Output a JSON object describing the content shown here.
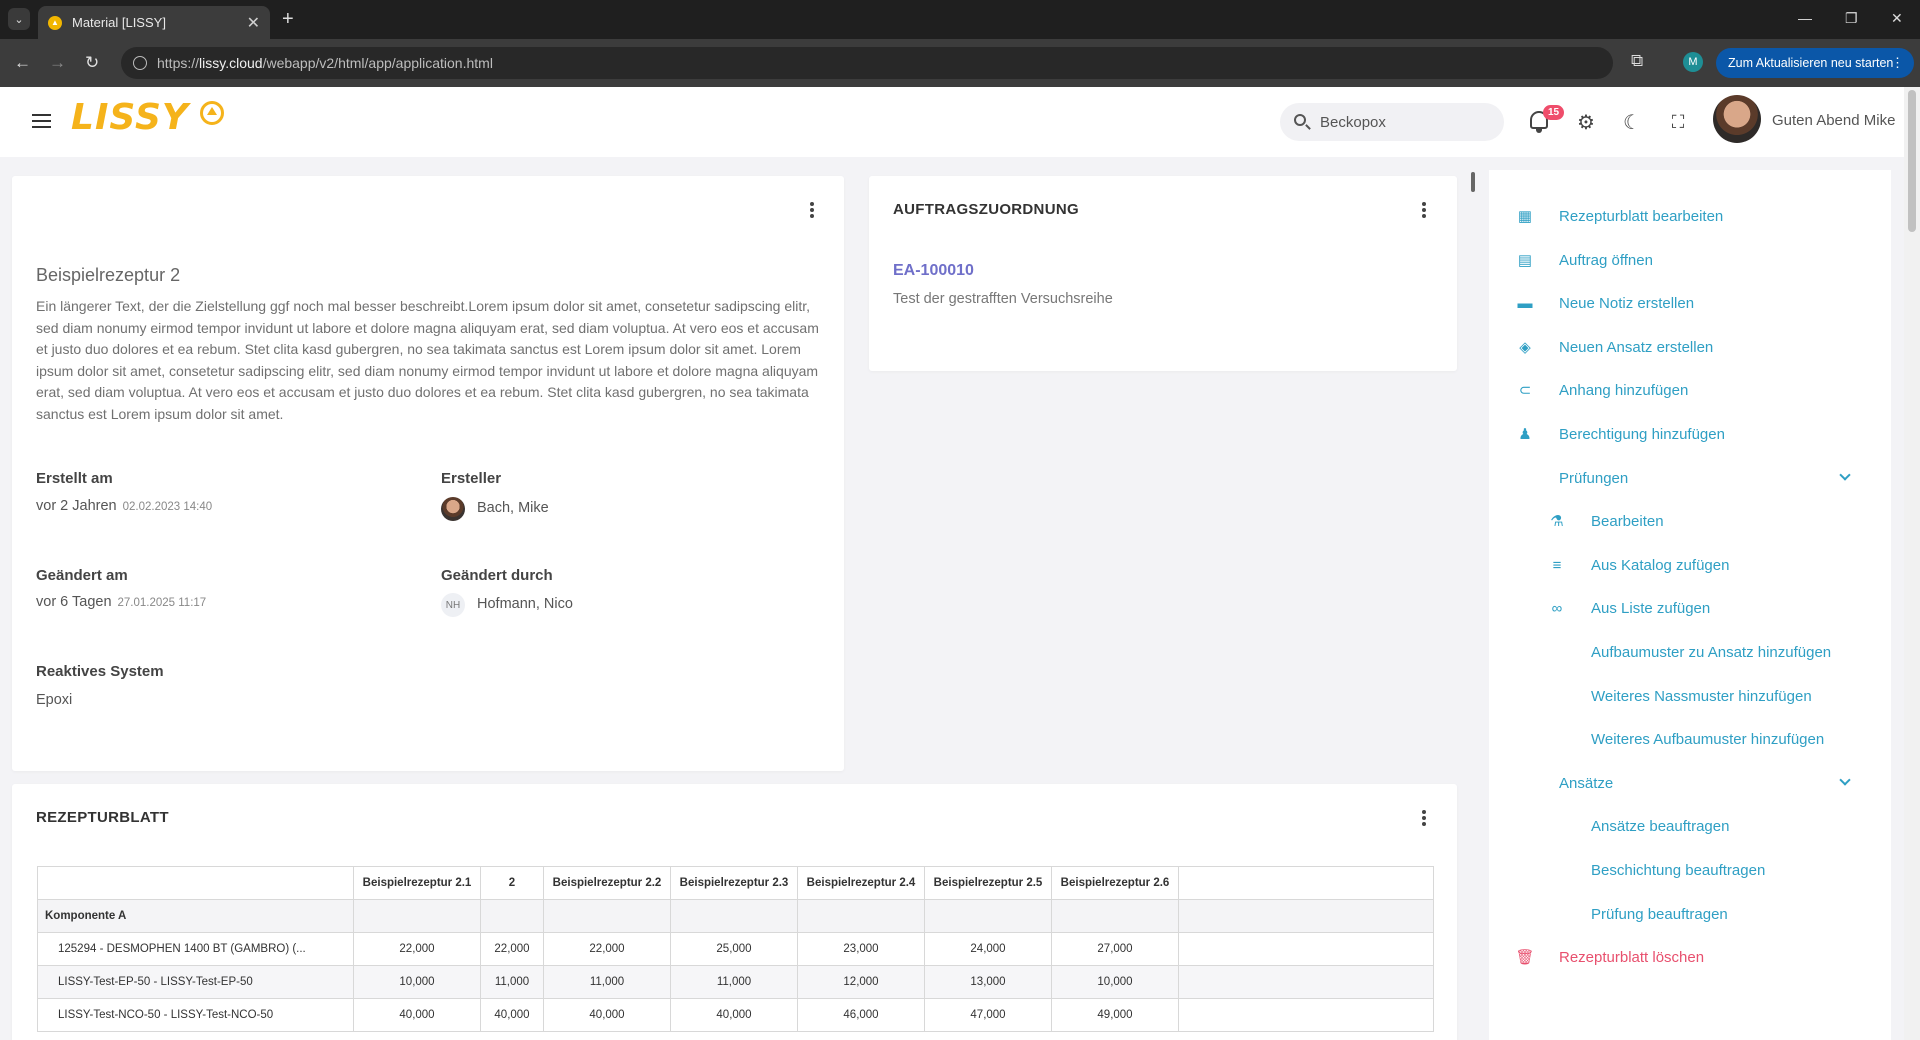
{
  "browser": {
    "tab_title": "Material [LISSY]",
    "url_scheme": "https://",
    "url_host": "lissy.cloud",
    "url_path": "/webapp/v2/html/app/application.html",
    "profile_initial": "M",
    "update_label": "Zum Aktualisieren neu starten"
  },
  "header": {
    "logo_text": "LISSY",
    "search_value": "Beckopox",
    "notification_count": "15",
    "greeting": "Guten Abend Mike"
  },
  "recipe_card": {
    "name": "Beispielrezeptur 2",
    "description": "Ein längerer Text, der die Zielstellung ggf noch mal besser beschreibt.Lorem ipsum dolor sit amet, consetetur sadipscing elitr, sed diam nonumy eirmod tempor invidunt ut labore et dolore magna aliquyam erat, sed diam voluptua. At vero eos et accusam et justo duo dolores et ea rebum. Stet clita kasd gubergren, no sea takimata sanctus est Lorem ipsum dolor sit amet. Lorem ipsum dolor sit amet, consetetur sadipscing elitr, sed diam nonumy eirmod tempor invidunt ut labore et dolore magna aliquyam erat, sed diam voluptua. At vero eos et accusam et justo duo dolores et ea rebum. Stet clita kasd gubergren, no sea takimata sanctus est Lorem ipsum dolor sit amet.",
    "created_label": "Erstellt am",
    "created_relative": "vor 2 Jahren",
    "created_date": "02.02.2023 14:40",
    "creator_label": "Ersteller",
    "creator_name": "Bach, Mike",
    "changed_label": "Geändert am",
    "changed_relative": "vor 6 Tagen",
    "changed_date": "27.01.2025 11:17",
    "changed_by_label": "Geändert durch",
    "changed_by_initials": "NH",
    "changed_by_name": "Hofmann, Nico",
    "system_label": "Reaktives System",
    "system_value": "Epoxi"
  },
  "order_card": {
    "title": "AUFTRAGSZUORDNUNG",
    "order_id": "EA-100010",
    "order_desc": "Test der gestrafften Versuchsreihe"
  },
  "sheet_card": {
    "title": "REZEPTURBLATT",
    "columns": [
      "Beispielrezeptur 2.1",
      "2",
      "Beispielrezeptur 2.2",
      "Beispielrezeptur 2.3",
      "Beispielrezeptur 2.4",
      "Beispielrezeptur 2.5",
      "Beispielrezeptur 2.6"
    ],
    "group": "Komponente A",
    "rows": [
      {
        "name": "125294 - DESMOPHEN 1400 BT (GAMBRO) (...",
        "values": [
          "22,000",
          "22,000",
          "22,000",
          "25,000",
          "23,000",
          "24,000",
          "27,000"
        ]
      },
      {
        "name": "LISSY-Test-EP-50 - LISSY-Test-EP-50",
        "values": [
          "10,000",
          "11,000",
          "11,000",
          "11,000",
          "12,000",
          "13,000",
          "10,000"
        ]
      },
      {
        "name": "LISSY-Test-NCO-50 - LISSY-Test-NCO-50",
        "values": [
          "40,000",
          "40,000",
          "40,000",
          "40,000",
          "46,000",
          "47,000",
          "49,000"
        ]
      }
    ]
  },
  "side_menu": {
    "edit_sheet": "Rezepturblatt bearbeiten",
    "open_order": "Auftrag öffnen",
    "new_note": "Neue Notiz erstellen",
    "new_batch": "Neuen Ansatz erstellen",
    "add_attachment": "Anhang hinzufügen",
    "add_permission": "Berechtigung hinzufügen",
    "tests": "Prüfungen",
    "tests_edit": "Bearbeiten",
    "tests_catalog": "Aus Katalog zufügen",
    "tests_list": "Aus Liste zufügen",
    "tests_build": "Aufbaumuster zu Ansatz hinzufügen",
    "tests_wet": "Weiteres Nassmuster hinzufügen",
    "tests_more_build": "Weiteres Aufbaumuster hinzufügen",
    "batches": "Ansätze",
    "batches_order": "Ansätze beauftragen",
    "coating_order": "Beschichtung beauftragen",
    "test_order": "Prüfung beauftragen",
    "delete_sheet": "Rezepturblatt löschen"
  }
}
